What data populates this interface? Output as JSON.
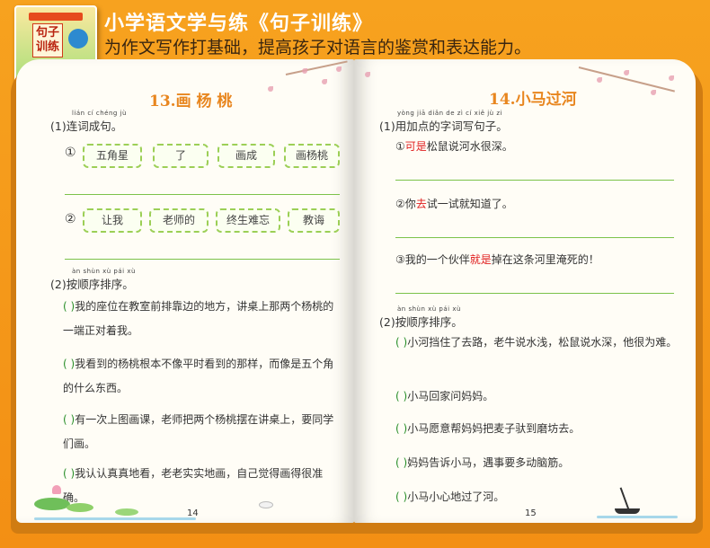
{
  "header": {
    "title": "小学语文学与练《句子训练》",
    "subtitle": "为作文写作打基础，提高孩子对语言的鉴赏和表达能力。",
    "cover_title": "句子训练",
    "cover_logo": "",
    "cover_badge": ""
  },
  "left_page": {
    "lesson_title": "13.画 杨 桃",
    "q1": {
      "pinyin": "lián  cí  chéng jù",
      "label": "(1)连词成句。"
    },
    "q1_rows": [
      {
        "num": "①",
        "words": [
          "五角星",
          "了",
          "画成",
          "画杨桃"
        ]
      },
      {
        "num": "②",
        "words": [
          "让我",
          "老师的",
          "终生难忘",
          "教诲"
        ]
      }
    ],
    "q2": {
      "pinyin": "àn shùn xù pái xù",
      "label": "(2)按顺序排序。"
    },
    "q2_items": [
      {
        "paren": "(        )",
        "text": "我的座位在教室前排靠边的地方，讲桌上那两个杨桃的一端正对着我。"
      },
      {
        "paren": "(        )",
        "text": "我看到的杨桃根本不像平时看到的那样，而像是五个角的什么东西。"
      },
      {
        "paren": "(        )",
        "text": "有一次上图画课，老师把两个杨桃摆在讲桌上，要同学们画。"
      },
      {
        "paren": "(        )",
        "text": "我认认真真地看，老老实实地画，自己觉得画得很准确。"
      }
    ],
    "page_number": "14"
  },
  "right_page": {
    "lesson_title": "14.小马过河",
    "q1": {
      "pinyin": "yòng jiā diǎn de zì cí xiě jù zi",
      "label": "(1)用加点的字词写句子。"
    },
    "q1_items": [
      {
        "num": "①",
        "hl": "可是",
        "rest": "松鼠说河水很深。",
        "pre": ""
      },
      {
        "num": "②",
        "pre": "你",
        "hl": "去",
        "rest": "试一试就知道了。"
      },
      {
        "num": "③",
        "pre": "我的一个伙伴",
        "hl": "就是",
        "rest": "掉在这条河里淹死的！"
      }
    ],
    "q2": {
      "pinyin": "àn shùn xù pái xù",
      "label": "(2)按顺序排序。"
    },
    "q2_items": [
      {
        "paren": "(        )",
        "text": "小河挡住了去路，老牛说水浅，松鼠说水深，他很为难。"
      },
      {
        "paren": "(        )",
        "text": "小马回家问妈妈。"
      },
      {
        "paren": "(        )",
        "text": "小马愿意帮妈妈把麦子驮到磨坊去。"
      },
      {
        "paren": "(        )",
        "text": "妈妈告诉小马，遇事要多动脑筋。"
      },
      {
        "paren": "(        )",
        "text": "小马小心地过了河。"
      }
    ],
    "page_number": "15"
  },
  "colors": {
    "background": "#f59a1c",
    "lesson_title": "#e8861f",
    "box_border": "#9ccf56",
    "rule": "#7cc24a",
    "paren": "#2a8f2a",
    "highlight": "#e02020"
  }
}
